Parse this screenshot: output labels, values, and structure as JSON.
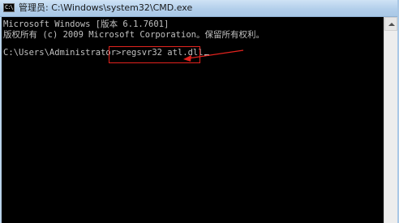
{
  "window": {
    "title": "管理员: C:\\Windows\\system32\\CMD.exe",
    "icon_text": "C:\\"
  },
  "console": {
    "line1": "Microsoft Windows [版本 6.1.7601]",
    "line2": "版权所有 (c) 2009 Microsoft Corporation。保留所有权利。",
    "prompt": "C:\\Users\\Administrator>",
    "command": "regsvr32 atl.dll"
  },
  "colors": {
    "console_background": "#000000",
    "console_text": "#c0c0c0",
    "annotation_red": "#e3231e"
  },
  "icons": {
    "window_icon": "cmd-icon",
    "scroll_up": "triangle-up-icon"
  }
}
